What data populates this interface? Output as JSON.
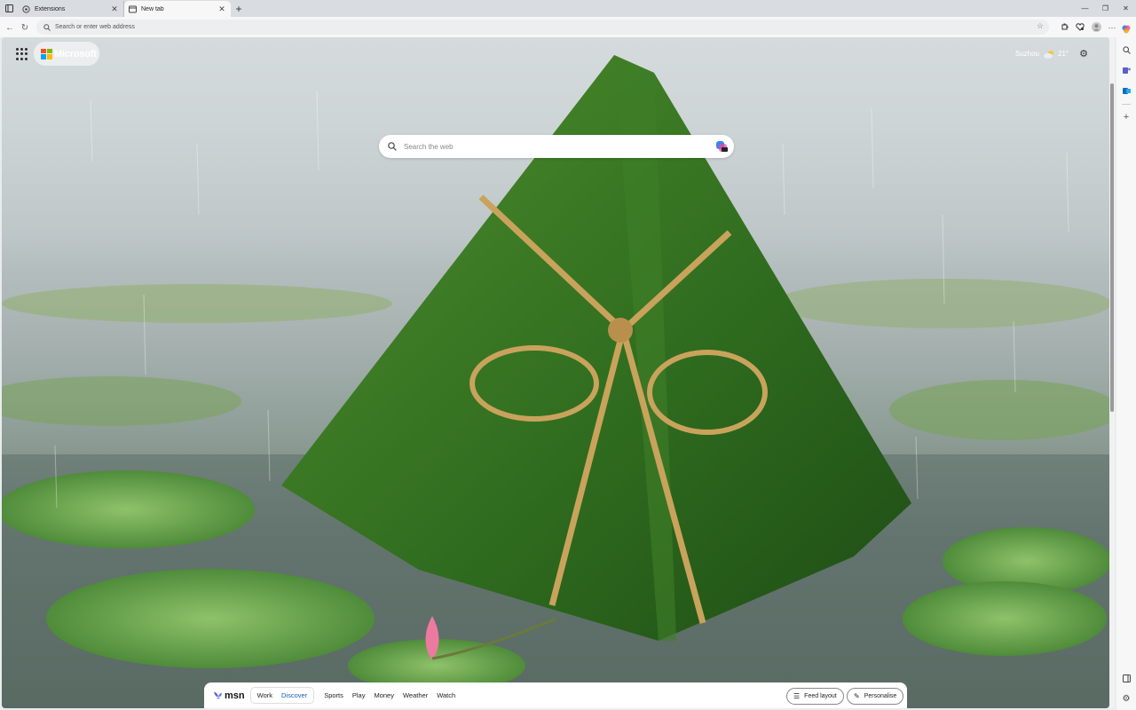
{
  "browser": {
    "tabs": [
      {
        "title": "Extensions",
        "active": false,
        "icon": "extensions-page-icon"
      },
      {
        "title": "New tab",
        "active": true,
        "icon": "new-tab-icon"
      }
    ],
    "new_tab_symbol": "+",
    "window_controls": [
      "minimize",
      "restore",
      "close"
    ],
    "address_bar": {
      "placeholder": "Search or enter web address"
    }
  },
  "page": {
    "brand": "Microsoft",
    "weather": {
      "city": "Suzhou",
      "temperature": "21°"
    },
    "search": {
      "placeholder": "Search the web"
    },
    "msn": {
      "logo_text": "msn",
      "segments": [
        {
          "label": "Work",
          "active": false
        },
        {
          "label": "Discover",
          "active": true
        }
      ],
      "nav_items": [
        "Sports",
        "Play",
        "Money",
        "Weather",
        "Watch"
      ],
      "feed_layout_label": "Feed layout",
      "personalise_label": "Personalise"
    }
  },
  "colors": {
    "accent": "#1a5fb4",
    "ms_red": "#f25022",
    "ms_green": "#7fba00",
    "ms_blue": "#00a4ef",
    "ms_yellow": "#ffb900"
  }
}
